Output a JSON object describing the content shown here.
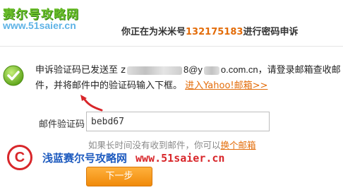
{
  "logo": {
    "line1": "赛尔号攻略网",
    "line2": "www.51saier.cn"
  },
  "title": {
    "prefix": "你正在为米米号",
    "number": "132175183",
    "suffix": "进行密码申诉"
  },
  "message": {
    "part1": "申诉验证码已发送至 z",
    "email_mid": "8@y",
    "email_tail": "o.com.cn",
    "part2": "，请登录邮箱查收邮件，并将邮件中的验证码输入下框。",
    "link": "进入Yahoo!邮箱>>"
  },
  "form": {
    "label": "邮件验证码：",
    "value": "bebd67",
    "hint": "如果长时间没有收到邮件，你可以",
    "hint_link": "换个邮箱"
  },
  "watermark": {
    "symbol": "C",
    "text": "浅蓝赛尔号攻略网",
    "url": "www.51saier.cn"
  },
  "button": {
    "next": "下一步"
  },
  "colors": {
    "accent": "#e36c09",
    "button": "#f39a1a",
    "watermark_blue": "#1e5bbf",
    "watermark_red": "#d8262a"
  }
}
